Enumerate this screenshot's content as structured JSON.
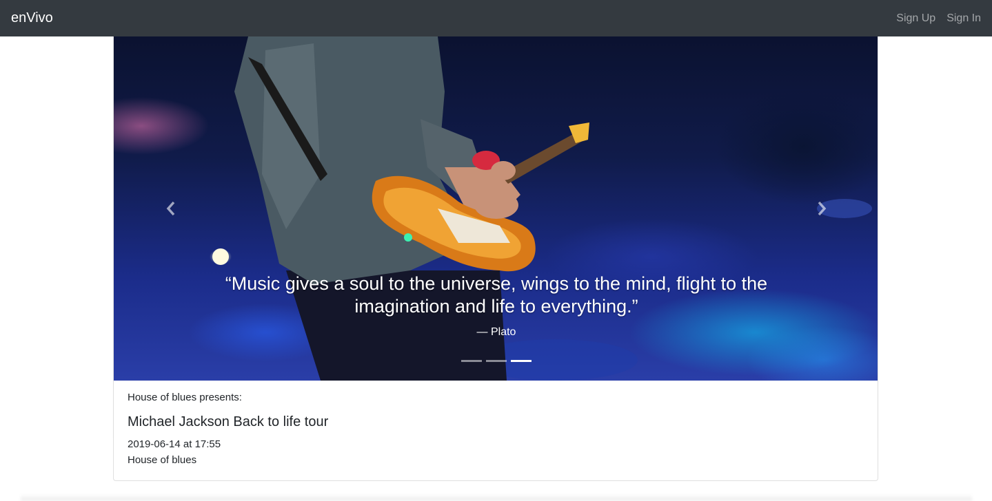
{
  "navbar": {
    "brand": "enVivo",
    "links": [
      {
        "label": "Sign Up"
      },
      {
        "label": "Sign In"
      }
    ]
  },
  "carousel": {
    "quote": "“Music gives a soul to the universe, wings to the mind, flight to the imagination and life to everything.”",
    "author": "— Plato",
    "slide_count": 3,
    "active_index": 2,
    "prev_icon": "chevron-left-icon",
    "next_icon": "chevron-right-icon"
  },
  "event": {
    "presenter": "House of blues presents:",
    "title": "Michael Jackson Back to life tour",
    "datetime": "2019-06-14 at 17:55",
    "venue": "House of blues"
  },
  "colors": {
    "navbar_bg": "#343a40",
    "nav_link": "rgba(255,255,255,0.55)",
    "text": "#212529"
  }
}
